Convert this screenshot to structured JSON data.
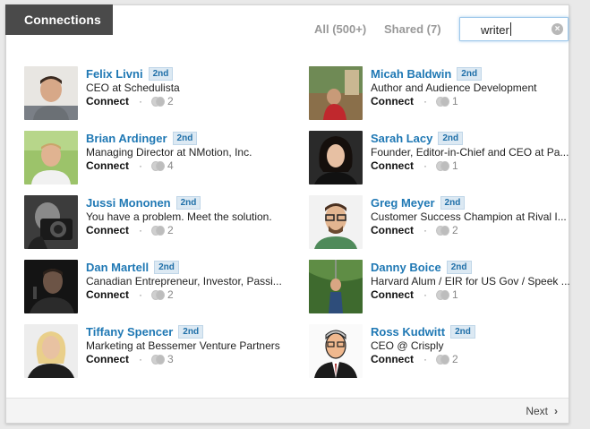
{
  "header": {
    "title": "Connections"
  },
  "filters": {
    "all": "All (500+)",
    "shared": "Shared (7)"
  },
  "search": {
    "value": "writer"
  },
  "left_column": [
    {
      "name": "Felix Livni",
      "degree": "2nd",
      "headline": "CEO at Schedulista",
      "shared": "2"
    },
    {
      "name": "Brian Ardinger",
      "degree": "2nd",
      "headline": "Managing Director at NMotion, Inc.",
      "shared": "4"
    },
    {
      "name": "Jussi Mononen",
      "degree": "2nd",
      "headline": "You have a problem. Meet the solution.",
      "shared": "2"
    },
    {
      "name": "Dan Martell",
      "degree": "2nd",
      "headline": "Canadian Entrepreneur, Investor, Passi...",
      "shared": "2"
    },
    {
      "name": "Tiffany Spencer",
      "degree": "2nd",
      "headline": "Marketing at Bessemer Venture Partners",
      "shared": "3"
    }
  ],
  "right_column": [
    {
      "name": "Micah Baldwin",
      "degree": "2nd",
      "headline": "Author and Audience Development",
      "shared": "1"
    },
    {
      "name": "Sarah Lacy",
      "degree": "2nd",
      "headline": "Founder, Editor-in-Chief and CEO at Pa...",
      "shared": "1"
    },
    {
      "name": "Greg Meyer",
      "degree": "2nd",
      "headline": "Customer Success Champion at Rival I...",
      "shared": "2"
    },
    {
      "name": "Danny Boice",
      "degree": "2nd",
      "headline": "Harvard Alum / EIR for US Gov / Speek ...",
      "shared": "1"
    },
    {
      "name": "Ross Kudwitt",
      "degree": "2nd",
      "headline": "CEO @ Crisply",
      "shared": "2"
    }
  ],
  "connect_label": "Connect",
  "separator": "·",
  "icons": {
    "clear": "clear-search-icon",
    "shared": "shared-connections-icon",
    "next": "chevron-right-icon"
  },
  "footer": {
    "next_label": "Next"
  },
  "colors": {
    "accent": "#1f78b4",
    "header_bg": "#4a4a4a",
    "badge_bg": "#dce9f3"
  }
}
